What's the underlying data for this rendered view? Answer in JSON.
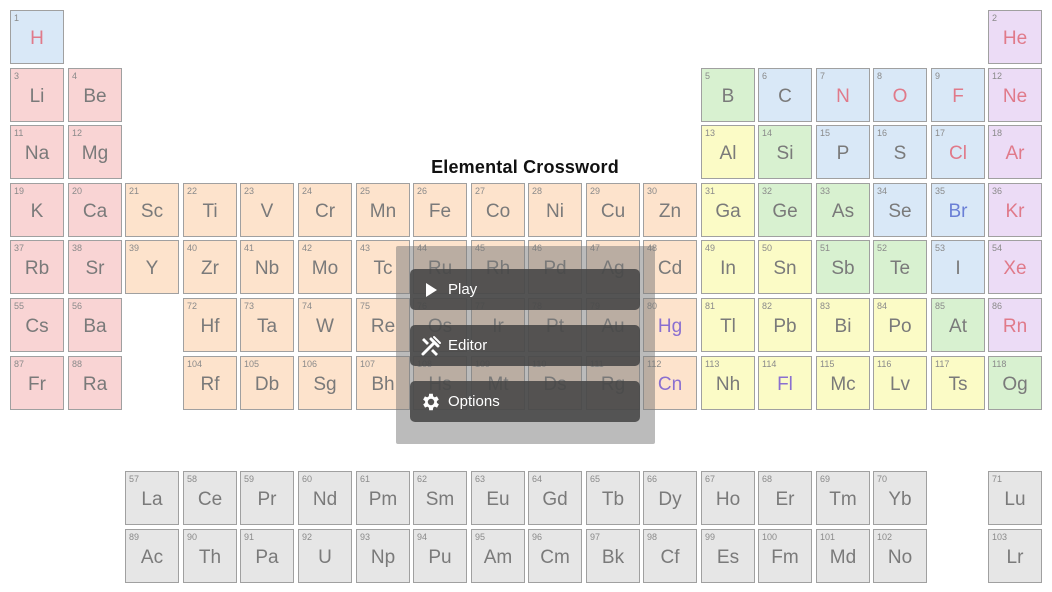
{
  "title": "Elemental Crossword",
  "menu": {
    "play_label": "Play",
    "editor_label": "Editor",
    "options_label": "Options"
  },
  "colors": {
    "alkali": "#f9d4d4",
    "alkali_earth": "#f9d4d4",
    "transition": "#fde3cc",
    "post_transition": "#fbfbc6",
    "metalloid": "#d8f1d0",
    "nonmetal": "#d9e8f7",
    "halogen": "#d9e8f7",
    "noble": "#ecdcf6",
    "lanthanide": "#e6e6e6",
    "unknown": "#e6e6e6"
  },
  "elements": [
    {
      "n": "1",
      "s": "H",
      "c": "nonmetal",
      "t": "#e07a8a"
    },
    {
      "n": "2",
      "s": "He",
      "c": "noble",
      "t": "#e07a8a"
    },
    {
      "n": "3",
      "s": "Li",
      "c": "alkali"
    },
    {
      "n": "4",
      "s": "Be",
      "c": "alkali_earth"
    },
    {
      "n": "5",
      "s": "B",
      "c": "metalloid"
    },
    {
      "n": "6",
      "s": "C",
      "c": "nonmetal"
    },
    {
      "n": "7",
      "s": "N",
      "c": "nonmetal",
      "t": "#e07a8a"
    },
    {
      "n": "8",
      "s": "O",
      "c": "nonmetal",
      "t": "#e07a8a"
    },
    {
      "n": "9",
      "s": "F",
      "c": "halogen",
      "t": "#e07a8a"
    },
    {
      "n": "12",
      "s": "Ne",
      "c": "noble",
      "t": "#e07a8a"
    },
    {
      "n": "11",
      "s": "Na",
      "c": "alkali"
    },
    {
      "n": "12",
      "s": "Mg",
      "c": "alkali_earth"
    },
    {
      "n": "13",
      "s": "Al",
      "c": "post_transition"
    },
    {
      "n": "14",
      "s": "Si",
      "c": "metalloid"
    },
    {
      "n": "15",
      "s": "P",
      "c": "nonmetal"
    },
    {
      "n": "16",
      "s": "S",
      "c": "nonmetal"
    },
    {
      "n": "17",
      "s": "Cl",
      "c": "halogen",
      "t": "#e07a8a"
    },
    {
      "n": "18",
      "s": "Ar",
      "c": "noble",
      "t": "#e07a8a"
    },
    {
      "n": "19",
      "s": "K",
      "c": "alkali"
    },
    {
      "n": "20",
      "s": "Ca",
      "c": "alkali_earth"
    },
    {
      "n": "21",
      "s": "Sc",
      "c": "transition"
    },
    {
      "n": "22",
      "s": "Ti",
      "c": "transition"
    },
    {
      "n": "23",
      "s": "V",
      "c": "transition"
    },
    {
      "n": "24",
      "s": "Cr",
      "c": "transition"
    },
    {
      "n": "25",
      "s": "Mn",
      "c": "transition"
    },
    {
      "n": "26",
      "s": "Fe",
      "c": "transition"
    },
    {
      "n": "27",
      "s": "Co",
      "c": "transition"
    },
    {
      "n": "28",
      "s": "Ni",
      "c": "transition"
    },
    {
      "n": "29",
      "s": "Cu",
      "c": "transition"
    },
    {
      "n": "30",
      "s": "Zn",
      "c": "transition"
    },
    {
      "n": "31",
      "s": "Ga",
      "c": "post_transition"
    },
    {
      "n": "32",
      "s": "Ge",
      "c": "metalloid"
    },
    {
      "n": "33",
      "s": "As",
      "c": "metalloid"
    },
    {
      "n": "34",
      "s": "Se",
      "c": "nonmetal"
    },
    {
      "n": "35",
      "s": "Br",
      "c": "halogen",
      "t": "#6a7fd6"
    },
    {
      "n": "36",
      "s": "Kr",
      "c": "noble",
      "t": "#e07a8a"
    },
    {
      "n": "37",
      "s": "Rb",
      "c": "alkali"
    },
    {
      "n": "38",
      "s": "Sr",
      "c": "alkali_earth"
    },
    {
      "n": "39",
      "s": "Y",
      "c": "transition"
    },
    {
      "n": "40",
      "s": "Zr",
      "c": "transition"
    },
    {
      "n": "41",
      "s": "Nb",
      "c": "transition"
    },
    {
      "n": "42",
      "s": "Mo",
      "c": "transition"
    },
    {
      "n": "43",
      "s": "Tc",
      "c": "transition"
    },
    {
      "n": "44",
      "s": "Ru",
      "c": "transition"
    },
    {
      "n": "45",
      "s": "Rh",
      "c": "transition"
    },
    {
      "n": "46",
      "s": "Pd",
      "c": "transition"
    },
    {
      "n": "47",
      "s": "Ag",
      "c": "transition"
    },
    {
      "n": "48",
      "s": "Cd",
      "c": "transition"
    },
    {
      "n": "49",
      "s": "In",
      "c": "post_transition"
    },
    {
      "n": "50",
      "s": "Sn",
      "c": "post_transition"
    },
    {
      "n": "51",
      "s": "Sb",
      "c": "metalloid"
    },
    {
      "n": "52",
      "s": "Te",
      "c": "metalloid"
    },
    {
      "n": "53",
      "s": "I",
      "c": "halogen"
    },
    {
      "n": "54",
      "s": "Xe",
      "c": "noble",
      "t": "#e07a8a"
    },
    {
      "n": "55",
      "s": "Cs",
      "c": "alkali"
    },
    {
      "n": "56",
      "s": "Ba",
      "c": "alkali_earth"
    },
    {
      "n": "72",
      "s": "Hf",
      "c": "transition"
    },
    {
      "n": "73",
      "s": "Ta",
      "c": "transition"
    },
    {
      "n": "74",
      "s": "W",
      "c": "transition"
    },
    {
      "n": "75",
      "s": "Re",
      "c": "transition"
    },
    {
      "n": "76",
      "s": "Os",
      "c": "transition"
    },
    {
      "n": "77",
      "s": "Ir",
      "c": "transition"
    },
    {
      "n": "78",
      "s": "Pt",
      "c": "transition"
    },
    {
      "n": "79",
      "s": "Au",
      "c": "transition"
    },
    {
      "n": "80",
      "s": "Hg",
      "c": "transition",
      "t": "#8a6fd0"
    },
    {
      "n": "81",
      "s": "Tl",
      "c": "post_transition"
    },
    {
      "n": "82",
      "s": "Pb",
      "c": "post_transition"
    },
    {
      "n": "83",
      "s": "Bi",
      "c": "post_transition"
    },
    {
      "n": "84",
      "s": "Po",
      "c": "post_transition"
    },
    {
      "n": "85",
      "s": "At",
      "c": "metalloid"
    },
    {
      "n": "86",
      "s": "Rn",
      "c": "noble",
      "t": "#e07a8a"
    },
    {
      "n": "87",
      "s": "Fr",
      "c": "alkali"
    },
    {
      "n": "88",
      "s": "Ra",
      "c": "alkali_earth"
    },
    {
      "n": "104",
      "s": "Rf",
      "c": "transition"
    },
    {
      "n": "105",
      "s": "Db",
      "c": "transition"
    },
    {
      "n": "106",
      "s": "Sg",
      "c": "transition"
    },
    {
      "n": "107",
      "s": "Bh",
      "c": "transition"
    },
    {
      "n": "108",
      "s": "Hs",
      "c": "transition"
    },
    {
      "n": "109",
      "s": "Mt",
      "c": "transition"
    },
    {
      "n": "110",
      "s": "Ds",
      "c": "transition"
    },
    {
      "n": "111",
      "s": "Rg",
      "c": "transition"
    },
    {
      "n": "112",
      "s": "Cn",
      "c": "transition",
      "t": "#8a6fd0"
    },
    {
      "n": "113",
      "s": "Nh",
      "c": "post_transition"
    },
    {
      "n": "114",
      "s": "Fl",
      "c": "post_transition",
      "t": "#8a6fd0"
    },
    {
      "n": "115",
      "s": "Mc",
      "c": "post_transition"
    },
    {
      "n": "116",
      "s": "Lv",
      "c": "post_transition"
    },
    {
      "n": "117",
      "s": "Ts",
      "c": "post_transition"
    },
    {
      "n": "118",
      "s": "Og",
      "c": "metalloid"
    },
    {
      "n": "57",
      "s": "La",
      "c": "lanthanide"
    },
    {
      "n": "58",
      "s": "Ce",
      "c": "lanthanide"
    },
    {
      "n": "59",
      "s": "Pr",
      "c": "lanthanide"
    },
    {
      "n": "60",
      "s": "Nd",
      "c": "lanthanide"
    },
    {
      "n": "61",
      "s": "Pm",
      "c": "lanthanide"
    },
    {
      "n": "62",
      "s": "Sm",
      "c": "lanthanide"
    },
    {
      "n": "63",
      "s": "Eu",
      "c": "lanthanide"
    },
    {
      "n": "64",
      "s": "Gd",
      "c": "lanthanide"
    },
    {
      "n": "65",
      "s": "Tb",
      "c": "lanthanide"
    },
    {
      "n": "66",
      "s": "Dy",
      "c": "lanthanide"
    },
    {
      "n": "67",
      "s": "Ho",
      "c": "lanthanide"
    },
    {
      "n": "68",
      "s": "Er",
      "c": "lanthanide"
    },
    {
      "n": "69",
      "s": "Tm",
      "c": "lanthanide"
    },
    {
      "n": "70",
      "s": "Yb",
      "c": "lanthanide"
    },
    {
      "n": "71",
      "s": "Lu",
      "c": "lanthanide"
    },
    {
      "n": "89",
      "s": "Ac",
      "c": "lanthanide"
    },
    {
      "n": "90",
      "s": "Th",
      "c": "lanthanide"
    },
    {
      "n": "91",
      "s": "Pa",
      "c": "lanthanide"
    },
    {
      "n": "92",
      "s": "U",
      "c": "lanthanide"
    },
    {
      "n": "93",
      "s": "Np",
      "c": "lanthanide"
    },
    {
      "n": "94",
      "s": "Pu",
      "c": "lanthanide"
    },
    {
      "n": "95",
      "s": "Am",
      "c": "lanthanide"
    },
    {
      "n": "96",
      "s": "Cm",
      "c": "lanthanide"
    },
    {
      "n": "97",
      "s": "Bk",
      "c": "lanthanide"
    },
    {
      "n": "98",
      "s": "Cf",
      "c": "lanthanide"
    },
    {
      "n": "99",
      "s": "Es",
      "c": "lanthanide"
    },
    {
      "n": "100",
      "s": "Fm",
      "c": "lanthanide"
    },
    {
      "n": "101",
      "s": "Md",
      "c": "lanthanide"
    },
    {
      "n": "102",
      "s": "No",
      "c": "lanthanide"
    },
    {
      "n": "103",
      "s": "Lr",
      "c": "lanthanide"
    }
  ]
}
